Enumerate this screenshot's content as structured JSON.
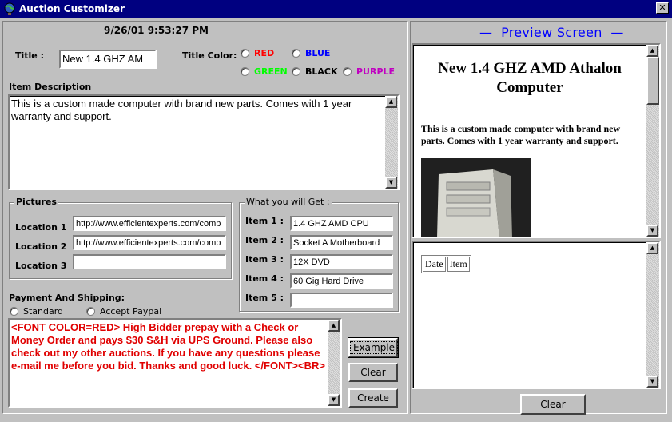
{
  "window": {
    "title": "Auction Customizer",
    "close": "✕"
  },
  "timestamp": "9/26/01 9:53:27 PM",
  "title_label": "Title :",
  "title_value": "New 1.4 GHZ AM",
  "title_color_label": "Title Color:",
  "colors": [
    {
      "label": "RED",
      "color": "#ff0000"
    },
    {
      "label": "BLUE",
      "color": "#0000ff"
    },
    {
      "label": "GREEN",
      "color": "#00ff00"
    },
    {
      "label": "BLACK",
      "color": "#000000"
    },
    {
      "label": "PURPLE",
      "color": "#c000c0"
    }
  ],
  "description_label": "Item Description",
  "description_text": "This is a custom made computer with brand new parts.  Comes with 1 year warranty and support.",
  "pictures": {
    "title": "Pictures",
    "locations": [
      {
        "label": "Location 1",
        "value": "http://www.efficientexperts.com/comp"
      },
      {
        "label": "Location 2",
        "value": "http://www.efficientexperts.com/comp"
      },
      {
        "label": "Location 3",
        "value": ""
      }
    ]
  },
  "get": {
    "title": "What you will Get :",
    "items": [
      {
        "label": "Item 1 :",
        "value": "1.4 GHZ AMD CPU"
      },
      {
        "label": "Item 2 :",
        "value": "Socket A Motherboard"
      },
      {
        "label": "Item 3 :",
        "value": "12X DVD"
      },
      {
        "label": "Item 4 :",
        "value": "60 Gig Hard Drive"
      },
      {
        "label": "Item 5 :",
        "value": ""
      }
    ]
  },
  "payment": {
    "label": "Payment And Shipping:",
    "options": [
      "Standard",
      "Accept Paypal"
    ],
    "text": "<FONT COLOR=RED> High Bidder prepay with a Check or Money Order and pays $30 S&H via UPS Ground.  Please also check out my other auctions.  If you have any questions please e-mail me before you bid.  Thanks and good luck.  </FONT><BR>"
  },
  "buttons": {
    "example": "Example",
    "clear": "Clear",
    "create": "Create",
    "preview_clear": "Clear"
  },
  "preview": {
    "header": "Preview Screen",
    "title": "New 1.4 GHZ AMD Athalon Computer",
    "description": "This is a custom made computer with brand new parts. Comes with 1 year warranty and support.",
    "table_headers": [
      "Date",
      "Item"
    ]
  },
  "icons": {
    "scroll_up": "▲",
    "scroll_down": "▼"
  }
}
